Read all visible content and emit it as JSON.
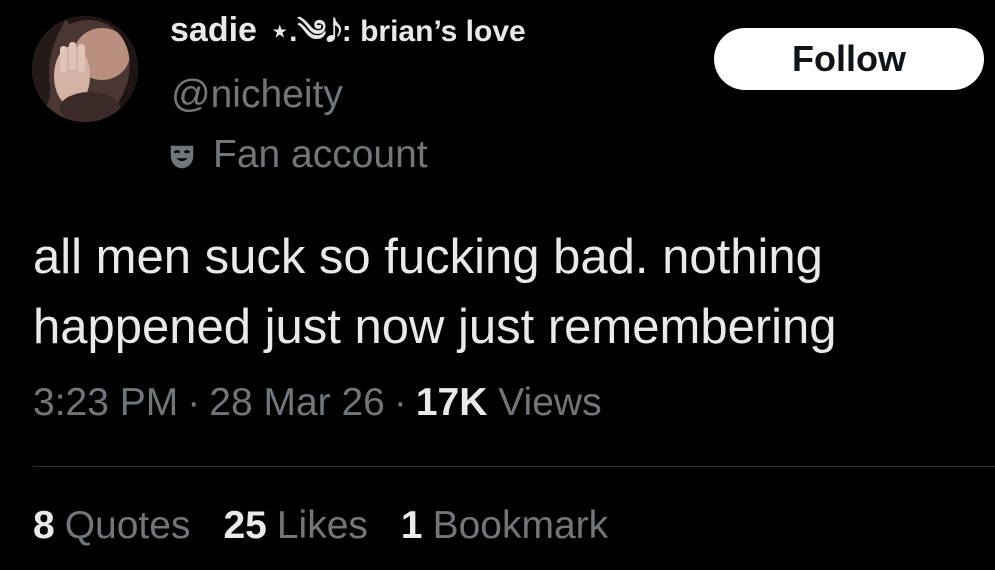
{
  "user": {
    "display_name": "sadie",
    "name_decoration": "⋆.༄𝅘𝅥𝅮: brian’s love",
    "handle": "@nicheity",
    "label": "Fan account",
    "label_icon": "theater-mask-icon",
    "avatar_icon": "profile-avatar"
  },
  "follow_button": {
    "label": "Follow"
  },
  "tweet": {
    "text": "all men suck so fucking bad. nothing happened just now just remembering"
  },
  "meta": {
    "time": "3:23 PM",
    "separator": "·",
    "date": "28 Mar 26",
    "views_count": "17K",
    "views_label": "Views"
  },
  "stats": {
    "quotes_count": "8",
    "quotes_label": "Quotes",
    "likes_count": "25",
    "likes_label": "Likes",
    "bookmarks_count": "1",
    "bookmarks_label": "Bookmark"
  },
  "colors": {
    "background": "#000000",
    "primary_text": "#e7e9ea",
    "secondary_text": "#71767b",
    "divider": "#2f3336",
    "follow_bg": "#ffffff",
    "follow_text": "#0f1419"
  }
}
